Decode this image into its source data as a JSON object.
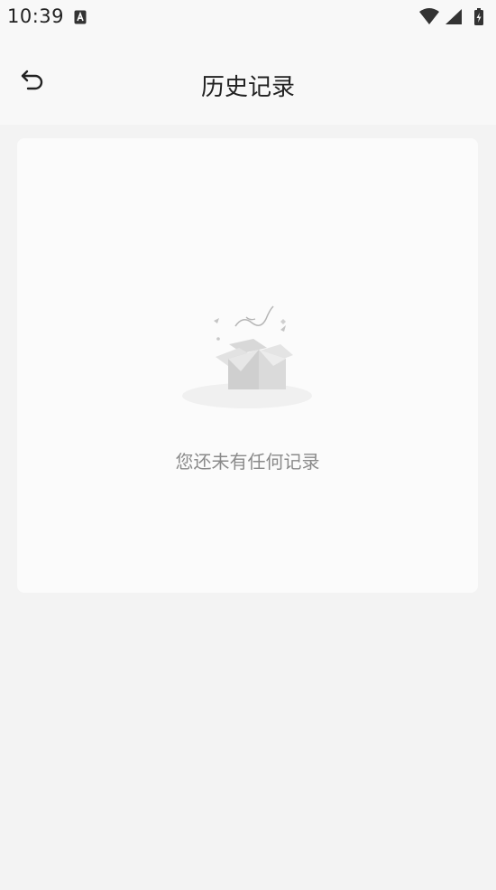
{
  "status_bar": {
    "time": "10:39",
    "app_icon": "app-notification-icon",
    "icons": [
      "wifi-icon",
      "cellular-signal-icon",
      "battery-charging-icon"
    ]
  },
  "header": {
    "back_icon": "back-arrow-icon",
    "title": "历史记录"
  },
  "empty_state": {
    "illustration": "empty-box-icon",
    "message": "您还未有任何记录"
  },
  "colors": {
    "page_background": "#f3f3f3",
    "header_background": "#f8f8f8",
    "card_background": "#fbfbfb",
    "title_text": "#222222",
    "empty_text": "#8a8a8a"
  }
}
